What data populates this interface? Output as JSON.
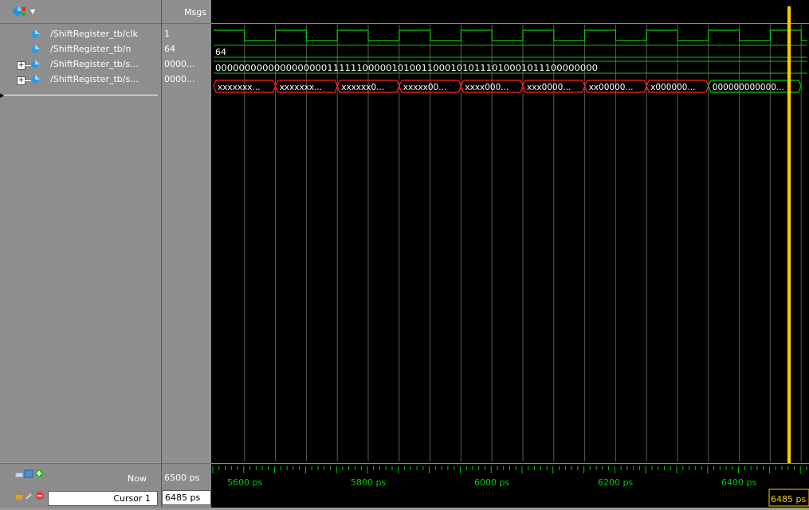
{
  "header": {
    "msgs_title": "Msgs"
  },
  "signals": [
    {
      "name": "/ShiftRegister_tb/clk",
      "value": "1",
      "expandable": false
    },
    {
      "name": "/ShiftRegister_tb/n",
      "value": "64",
      "expandable": false
    },
    {
      "name": "/ShiftRegister_tb/s...",
      "value": "0000...",
      "expandable": true
    },
    {
      "name": "/ShiftRegister_tb/s...",
      "value": "0000...",
      "expandable": true
    }
  ],
  "waves": {
    "n_label": "64",
    "bus1_label": "00000000000000000001111110000010100110001010111010001011100000000",
    "bus2_segments": [
      "xxxxxxx...",
      "xxxxxxx...",
      "xxxxxx0...",
      "xxxxx00...",
      "xxxx000...",
      "xxx0000...",
      "xx00000...",
      "x000000...",
      "000000000000..."
    ]
  },
  "timeline": {
    "tick_labels": [
      "5600 ps",
      "5800 ps",
      "6000 ps",
      "6200 ps",
      "6400 ps"
    ],
    "cursor_label": "6485 ps"
  },
  "status": {
    "now_label": "Now",
    "now_value": "6500 ps",
    "cursor_name": "Cursor 1",
    "cursor_value": "6485 ps"
  },
  "colors": {
    "wave_green": "#00cc00",
    "bus_red": "#ff2020",
    "cursor_yellow": "#ffcc00",
    "background": "#000000"
  },
  "icons": [
    "wave-toolbar-icon",
    "dropdown-icon",
    "signal-diamond-icon",
    "expand-plus-icon",
    "zoom-icon",
    "add-cursor-icon",
    "lock-icon",
    "edit-cursor-icon",
    "delete-cursor-icon"
  ]
}
